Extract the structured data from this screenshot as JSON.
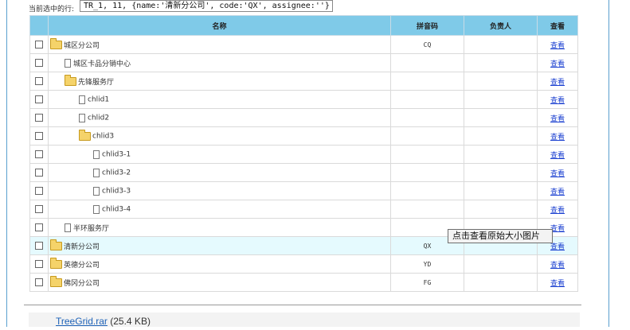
{
  "selected_row": {
    "label": "当前选中的行:",
    "value": "TR_1, 11, {name:'清新分公司', code:'QX', assignee:''}"
  },
  "table": {
    "headers": {
      "name": "名称",
      "code": "拼音码",
      "assignee": "负责人",
      "view": "查看"
    },
    "rows": [
      {
        "name": "城区分公司",
        "code": "CQ",
        "assignee": "",
        "view": "查看",
        "icon": "folder-icon",
        "indent": 0,
        "highlight": false
      },
      {
        "name": "城区卡品分销中心",
        "code": "",
        "assignee": "",
        "view": "查看",
        "icon": "file-icon",
        "indent": 1,
        "highlight": false
      },
      {
        "name": "先锋服务厅",
        "code": "",
        "assignee": "",
        "view": "查看",
        "icon": "folder-icon",
        "indent": 1,
        "highlight": false
      },
      {
        "name": "chlid1",
        "code": "",
        "assignee": "",
        "view": "查看",
        "icon": "file-icon",
        "indent": 2,
        "highlight": false
      },
      {
        "name": "chlid2",
        "code": "",
        "assignee": "",
        "view": "查看",
        "icon": "file-icon",
        "indent": 2,
        "highlight": false
      },
      {
        "name": "chlid3",
        "code": "",
        "assignee": "",
        "view": "查看",
        "icon": "folder-icon",
        "indent": 2,
        "highlight": false
      },
      {
        "name": "chlid3-1",
        "code": "",
        "assignee": "",
        "view": "查看",
        "icon": "file-icon",
        "indent": 3,
        "highlight": false
      },
      {
        "name": "chlid3-2",
        "code": "",
        "assignee": "",
        "view": "查看",
        "icon": "file-icon",
        "indent": 3,
        "highlight": false
      },
      {
        "name": "chlid3-3",
        "code": "",
        "assignee": "",
        "view": "查看",
        "icon": "file-icon",
        "indent": 3,
        "highlight": false
      },
      {
        "name": "chlid3-4",
        "code": "",
        "assignee": "",
        "view": "查看",
        "icon": "file-icon",
        "indent": 3,
        "highlight": false
      },
      {
        "name": "半环服务厅",
        "code": "",
        "assignee": "",
        "view": "查看",
        "icon": "file-icon",
        "indent": 1,
        "highlight": false
      },
      {
        "name": "清新分公司",
        "code": "QX",
        "assignee": "",
        "view": "查看",
        "icon": "folder-icon",
        "indent": 0,
        "highlight": true
      },
      {
        "name": "英德分公司",
        "code": "YD",
        "assignee": "",
        "view": "查看",
        "icon": "folder-icon",
        "indent": 0,
        "highlight": false
      },
      {
        "name": "佛冈分公司",
        "code": "FG",
        "assignee": "",
        "view": "查看",
        "icon": "folder-icon",
        "indent": 0,
        "highlight": false
      }
    ]
  },
  "tooltip": {
    "text": "点击查看原始大小图片"
  },
  "attachment": {
    "filename": "TreeGrid.rar",
    "size": "(25.4 KB)"
  }
}
